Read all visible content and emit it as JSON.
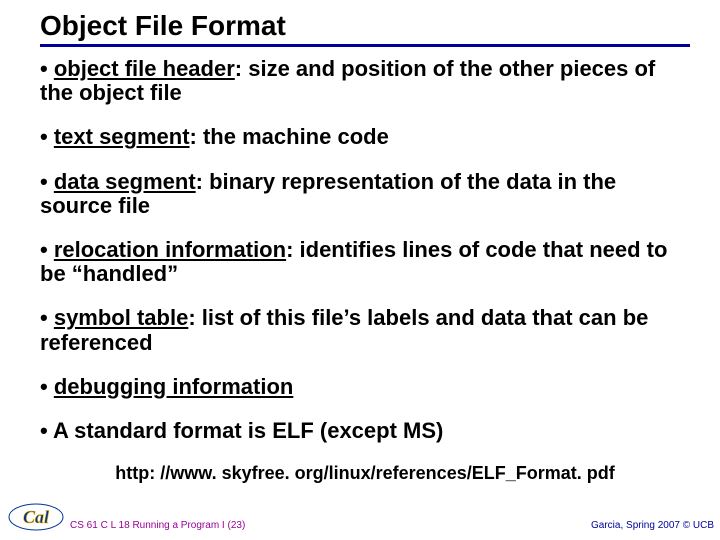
{
  "title": "Object File Format",
  "bullets": [
    {
      "term": "object file header",
      "rest": ": size and position of the other pieces of the object file"
    },
    {
      "term": "text segment",
      "rest": ": the machine code"
    },
    {
      "term": "data segment",
      "rest": ": binary representation of the data in the source file"
    },
    {
      "term": "relocation information",
      "rest": ": identifies lines of code that need to be “handled”"
    },
    {
      "term": "symbol table",
      "rest": ": list of this file’s labels and data that can be referenced"
    },
    {
      "term": "debugging information",
      "rest": ""
    },
    {
      "term": "",
      "rest": "A standard format is ELF (except MS)"
    }
  ],
  "url": "http: //www. skyfree. org/linux/references/ELF_Format. pdf",
  "footer": {
    "left": "CS 61 C L 18 Running a  Program I (23)",
    "right": "Garcia, Spring 2007 © UCB"
  }
}
